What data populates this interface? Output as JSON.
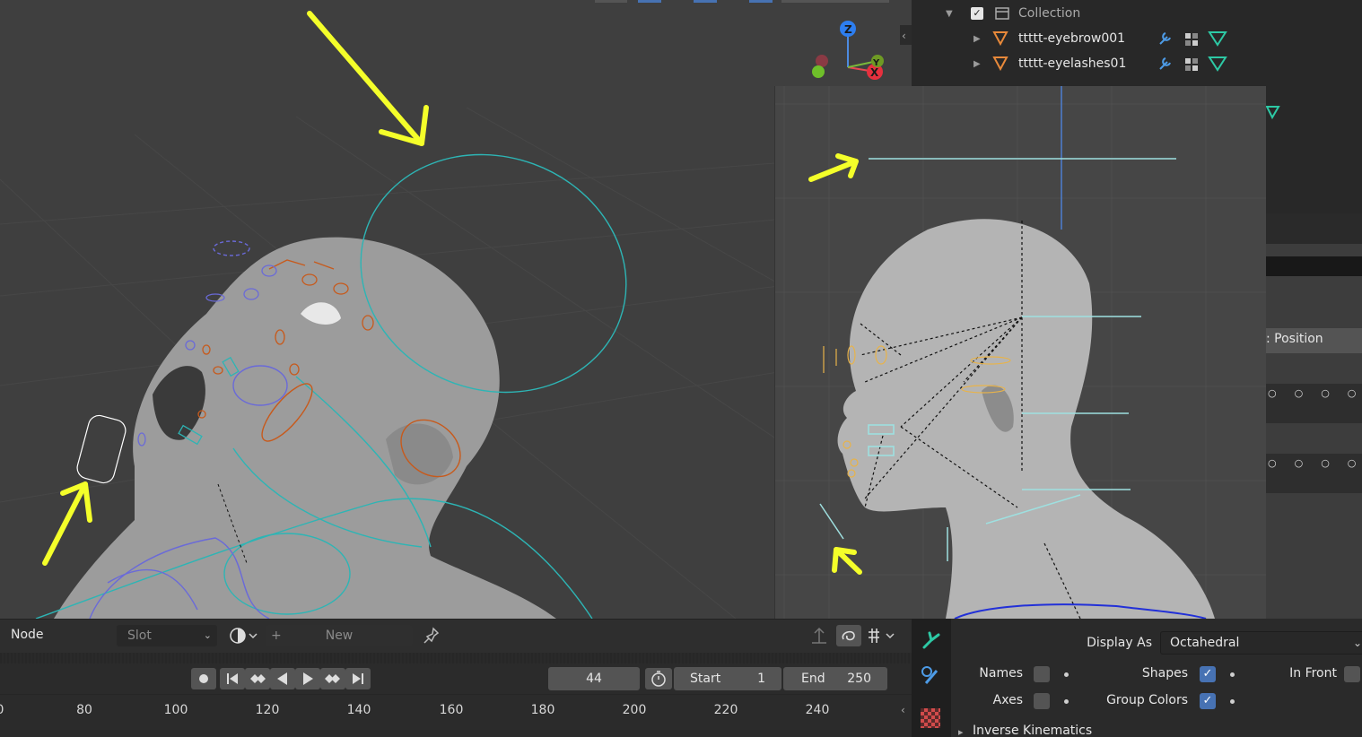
{
  "outliner": {
    "collection_label": "Collection",
    "rows": [
      {
        "label": "ttttt-eyebrow001"
      },
      {
        "label": "ttttt-eyelashes01"
      }
    ]
  },
  "viewport": {
    "gizmo": {
      "z_label": "Z",
      "x_label": "X",
      "y_label": "Y"
    },
    "properties_fragment": {
      "label": ": Position"
    }
  },
  "timeline_header": {
    "mode_label": "Node",
    "slot_label": "Slot",
    "new_label": "New",
    "plus_label": "+"
  },
  "timeline_controls": {
    "current_frame": "44",
    "start_label": "Start",
    "start_value": "1",
    "end_label": "End",
    "end_value": "250"
  },
  "ruler": {
    "ticks": [
      "80",
      "100",
      "120",
      "140",
      "160",
      "180",
      "200",
      "220",
      "240"
    ]
  },
  "armature_display": {
    "display_as_label": "Display As",
    "display_as_value": "Octahedral",
    "names_label": "Names",
    "names_checked": false,
    "shapes_label": "Shapes",
    "shapes_checked": true,
    "in_front_label": "In Front",
    "in_front_checked": false,
    "axes_label": "Axes",
    "axes_checked": false,
    "group_colors_label": "Group Colors",
    "group_colors_checked": true,
    "next_section_label": "Inverse Kinematics"
  },
  "colors": {
    "accent_blue": "#4772b3",
    "highlight_yellow": "#f4ff2a",
    "bone_cyan": "#2db5b5",
    "bone_orange": "#c75a1c",
    "bone_blue": "#6a6ad8",
    "mesh_orange": "#e8893a"
  }
}
